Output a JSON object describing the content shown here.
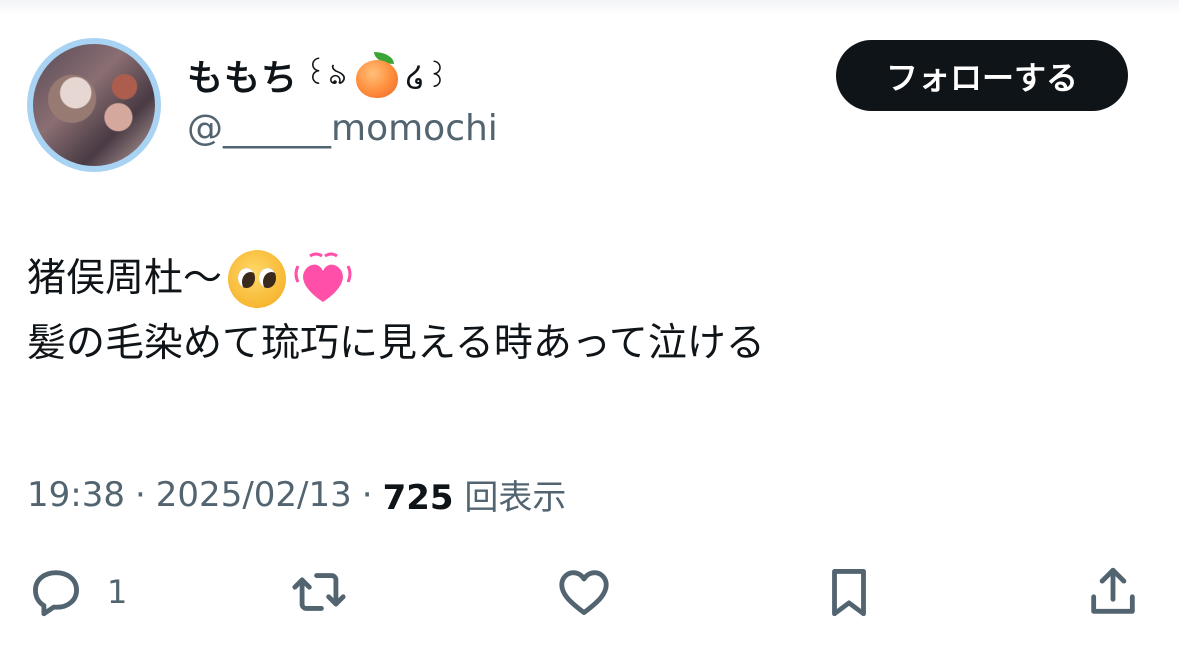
{
  "user": {
    "display_name": "ももち",
    "paren_left": "꒰ঌ",
    "paren_right": "໒꒱",
    "handle": "@______momochi",
    "emoji_icon": "peach-icon"
  },
  "follow_button": {
    "label": "フォローする"
  },
  "tweet": {
    "line1": "猪俣周杜〜",
    "line2": "髪の毛染めて琉巧に見える時あって泣ける",
    "line1_emojis": [
      "pleading-face-icon",
      "beating-heart-icon"
    ]
  },
  "meta": {
    "time": "19:38",
    "separator": "·",
    "date": "2025/02/13",
    "views_count": "725",
    "views_label": "回表示"
  },
  "actions": {
    "reply_count": "1",
    "icons": [
      "reply-icon",
      "retweet-icon",
      "like-icon",
      "bookmark-icon",
      "share-icon"
    ]
  },
  "colors": {
    "text_primary": "#0f1419",
    "text_secondary": "#536471",
    "button_bg": "#0f1419",
    "avatar_ring": "#a9d3f2"
  }
}
